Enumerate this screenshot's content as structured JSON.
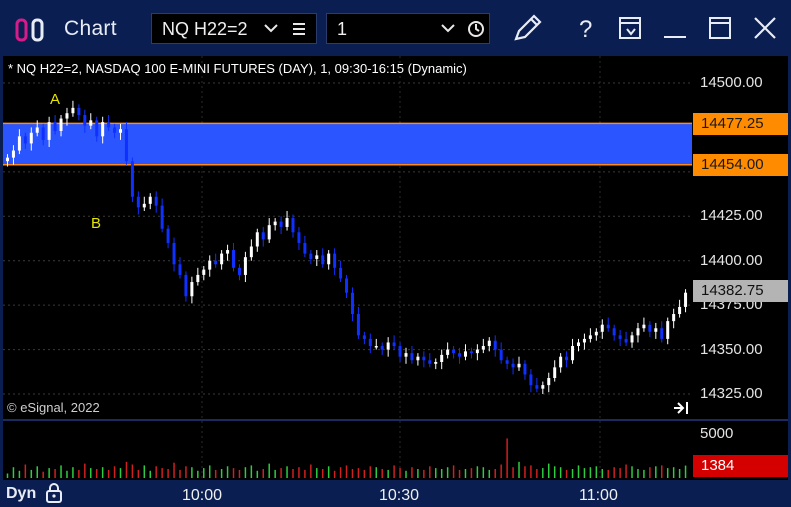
{
  "window": {
    "title": "Chart",
    "symbol_value": "NQ H22=2",
    "interval_value": "1",
    "icons": [
      "app-icon",
      "chevron-down-icon",
      "menu-icon",
      "clock-icon",
      "draw-tool-icon",
      "help-icon",
      "dropdown-window-icon",
      "minimize-icon",
      "maximize-icon",
      "close-icon"
    ]
  },
  "chart": {
    "title_text": "* NQ H22=2, NASDAQ 100 E-MINI FUTURES (DAY), 1, 09:30-16:15 (Dynamic)",
    "copyright": "© eSignal, 2022",
    "zone_labels": {
      "top": "A",
      "bottom": "B"
    },
    "price_labels": [
      "14500.00",
      "14454.00",
      "14425.00",
      "14400.00",
      "14375.00",
      "14350.00",
      "14325.00"
    ],
    "highlighted_prices": {
      "zone_top": "14477.25",
      "zone_bottom": "14454.00",
      "last": "14382.75"
    },
    "volume_labels": {
      "max": "5000",
      "last": "1384"
    },
    "time_labels": [
      "10:00",
      "10:30",
      "11:00"
    ],
    "mode_label": "Dyn",
    "colors": {
      "up": "#ffffff",
      "down": "#1030ff",
      "zone": "#2a55ff",
      "zone_border": "#ff8c1a",
      "price_box": "#ff8c00",
      "last_box": "#b0b0b0",
      "volume_last": "#d40000"
    }
  },
  "chart_data": {
    "type": "candlestick",
    "ylim": [
      14312,
      14512
    ],
    "zone": {
      "top": 14477.25,
      "bottom": 14454.0
    },
    "candles_close": [
      14458,
      14462,
      14470,
      14466,
      14472,
      14475,
      14468,
      14478,
      14473,
      14480,
      14483,
      14486,
      14482,
      14476,
      14479,
      14470,
      14478,
      14475,
      14472,
      14474,
      14456,
      14436,
      14430,
      14432,
      14436,
      14431,
      14418,
      14410,
      14398,
      14392,
      14380,
      14388,
      14392,
      14395,
      14400,
      14398,
      14404,
      14406,
      14396,
      14392,
      14402,
      14408,
      14416,
      14412,
      14420,
      14422,
      14419,
      14424,
      14416,
      14410,
      14404,
      14401,
      14403,
      14398,
      14404,
      14396,
      14390,
      14382,
      14370,
      14358,
      14356,
      14352,
      14352,
      14350,
      14354,
      14352,
      14346,
      14348,
      14344,
      14346,
      14344,
      14342,
      14343,
      14347,
      14350,
      14348,
      14346,
      14349,
      14348,
      14350,
      14352,
      14355,
      14350,
      14344,
      14342,
      14340,
      14342,
      14336,
      14330,
      14328,
      14330,
      14334,
      14340,
      14346,
      14344,
      14352,
      14354,
      14356,
      14358,
      14360,
      14364,
      14362,
      14358,
      14356,
      14354,
      14358,
      14362,
      14364,
      14360,
      14362,
      14356,
      14366,
      14370,
      14374,
      14382
    ],
    "volume": [
      500,
      1200,
      800,
      1500,
      900,
      1300,
      700,
      1100,
      1000,
      1400,
      800,
      1200,
      900,
      1600,
      1100,
      1000,
      1200,
      900,
      1300,
      1100,
      1800,
      1500,
      900,
      1400,
      800,
      1300,
      1100,
      1000,
      1700,
      900,
      1300,
      1200,
      800,
      1100,
      1400,
      900,
      1000,
      1300,
      1100,
      900,
      1200,
      1400,
      800,
      1000,
      1600,
      900,
      1100,
      1300,
      1000,
      1200,
      900,
      1500,
      1100,
      1000,
      1300,
      800,
      1200,
      1400,
      1000,
      1100,
      900,
      1300,
      1200,
      1000,
      900,
      1400,
      1100,
      800,
      1200,
      1000,
      900,
      1300,
      1100,
      1000,
      1200,
      1400,
      900,
      1000,
      1100,
      1300,
      1200,
      900,
      1000,
      1500,
      4400,
      1200,
      1800,
      1300,
      1400,
      1000,
      1100,
      1600,
      1300,
      1200,
      900,
      1000,
      1400,
      1100,
      1200,
      1300,
      1000,
      900,
      1200,
      1100,
      1500,
      1300,
      1000,
      900,
      1200,
      1300,
      1400,
      1100,
      1200,
      1000,
      1384
    ]
  }
}
